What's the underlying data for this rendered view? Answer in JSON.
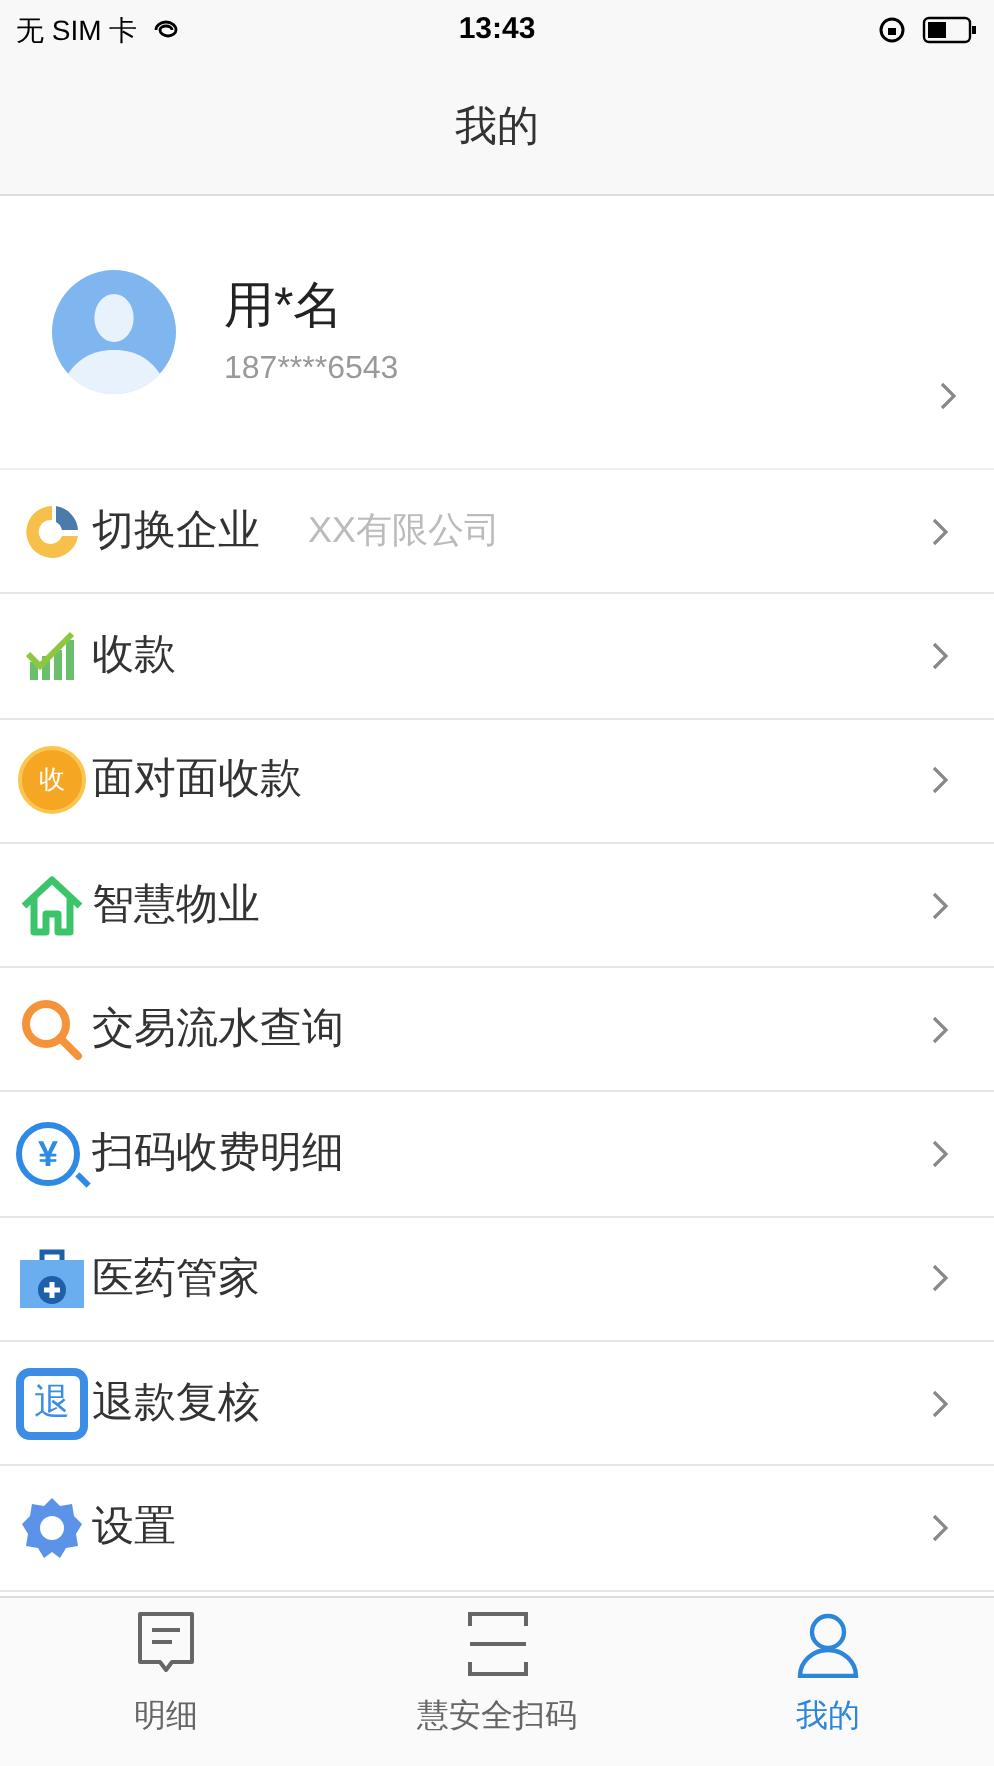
{
  "status_bar": {
    "carrier": "无 SIM 卡",
    "time": "13:43"
  },
  "header": {
    "title": "我的"
  },
  "profile": {
    "name": "用*名",
    "phone": "187****6543"
  },
  "menu": [
    {
      "label": "切换企业",
      "value": "XX有限公司"
    },
    {
      "label": "收款"
    },
    {
      "label": "面对面收款",
      "icon_text": "收"
    },
    {
      "label": "智慧物业"
    },
    {
      "label": "交易流水查询"
    },
    {
      "label": "扫码收费明细",
      "icon_text": "¥"
    },
    {
      "label": "医药管家"
    },
    {
      "label": "退款复核",
      "icon_text": "退"
    },
    {
      "label": "设置"
    }
  ],
  "tab_bar": [
    {
      "label": "明细",
      "selected": false
    },
    {
      "label": "慧安全扫码",
      "selected": false
    },
    {
      "label": "我的",
      "selected": true
    }
  ]
}
